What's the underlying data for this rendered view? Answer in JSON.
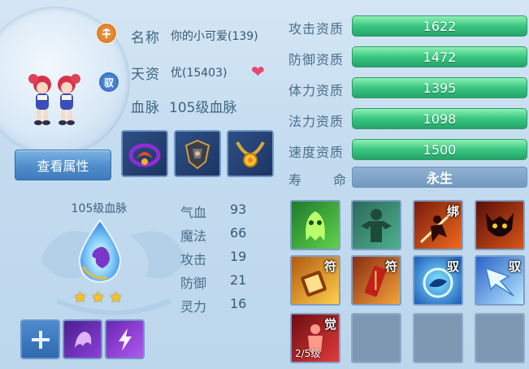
{
  "pet": {
    "name_label": "名称",
    "name_value": "你的小可爱(139)",
    "talent_label": "天资",
    "talent_value": "优(15403)",
    "bloodline_label": "血脉",
    "bloodline_value": "105级血脉",
    "type_icon": "spirit-type-icon",
    "tame_icon_text": "驭"
  },
  "buttons": {
    "view_attributes": "查看属性"
  },
  "bloodline": {
    "title": "105级血脉",
    "stars": 3
  },
  "stats": [
    {
      "label": "气血",
      "value": "93"
    },
    {
      "label": "魔法",
      "value": "66"
    },
    {
      "label": "攻击",
      "value": "19"
    },
    {
      "label": "防御",
      "value": "21"
    },
    {
      "label": "灵力",
      "value": "16"
    }
  ],
  "aptitudes": [
    {
      "label": "攻击资质",
      "value": "1622"
    },
    {
      "label": "防御资质",
      "value": "1472"
    },
    {
      "label": "体力资质",
      "value": "1395"
    },
    {
      "label": "法力资质",
      "value": "1098"
    },
    {
      "label": "速度资质",
      "value": "1500"
    }
  ],
  "lifespan": {
    "label_a": "寿",
    "label_b": "命",
    "value": "永生"
  },
  "skills": [
    {
      "tag": "",
      "level": ""
    },
    {
      "tag": "",
      "level": ""
    },
    {
      "tag": "绑",
      "level": ""
    },
    {
      "tag": "",
      "level": ""
    },
    {
      "tag": "符",
      "level": ""
    },
    {
      "tag": "符",
      "level": ""
    },
    {
      "tag": "驭",
      "level": ""
    },
    {
      "tag": "驭",
      "level": ""
    },
    {
      "tag": "觉",
      "level": "2/5级"
    }
  ],
  "colors": {
    "aptitude_bar": "#39c682",
    "life_bar": "#7498be",
    "button": "#4f8dcb",
    "star": "#ffc21a",
    "heart": "#e8466d"
  }
}
